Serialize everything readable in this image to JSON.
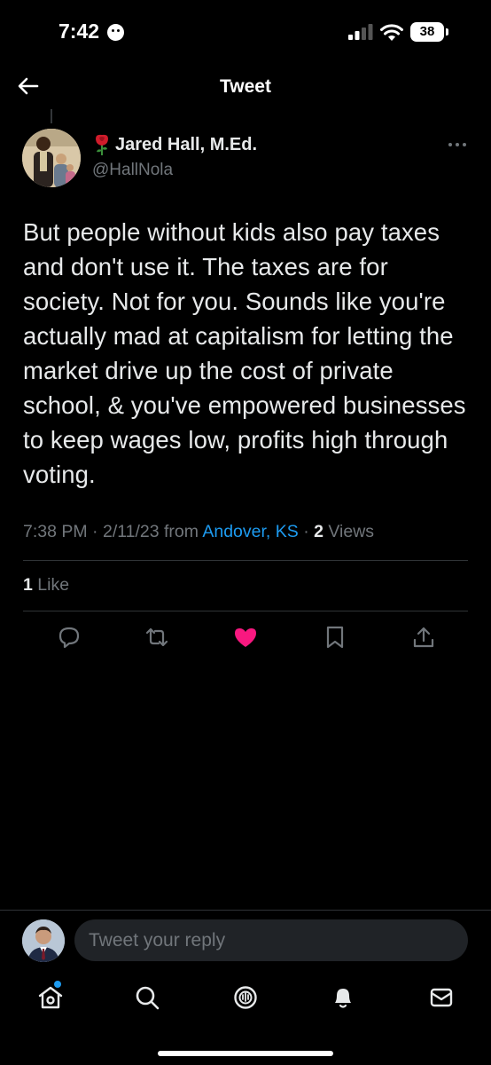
{
  "status_bar": {
    "time": "7:42",
    "battery": "38",
    "icons": [
      "focus-moon-icon",
      "signal-icon",
      "wifi-icon",
      "battery-icon"
    ]
  },
  "header": {
    "title": "Tweet",
    "back_icon": "arrow-left-icon"
  },
  "tweet": {
    "author_name": "Jared Hall, M.Ed.",
    "author_emoji": "rose-icon",
    "author_handle": "@HallNola",
    "text": "But people without kids also pay taxes and don't use it. The taxes are for society. Not for you. Sounds like you're actually mad at capitalism for letting the market drive up the cost of private school, & you've empowered businesses to keep wages low, profits high through voting.",
    "time": "7:38 PM",
    "dot1": "·",
    "date": "2/11/23",
    "from_label": "from",
    "location": "Andover, KS",
    "dot2": "·",
    "views_count": "2",
    "views_label": "Views",
    "likes_count": "1",
    "likes_label": "Like"
  },
  "actions": [
    "reply-icon",
    "retweet-icon",
    "like-icon",
    "bookmark-icon",
    "share-icon"
  ],
  "reply_bar": {
    "placeholder": "Tweet your reply"
  },
  "tabbar": [
    "home-icon",
    "search-icon",
    "spaces-icon",
    "notifications-icon",
    "messages-icon"
  ],
  "colors": {
    "background": "#000000",
    "text": "#e7e9ea",
    "secondary": "#71767b",
    "accent": "#1d9bf0",
    "like": "#f91880"
  }
}
